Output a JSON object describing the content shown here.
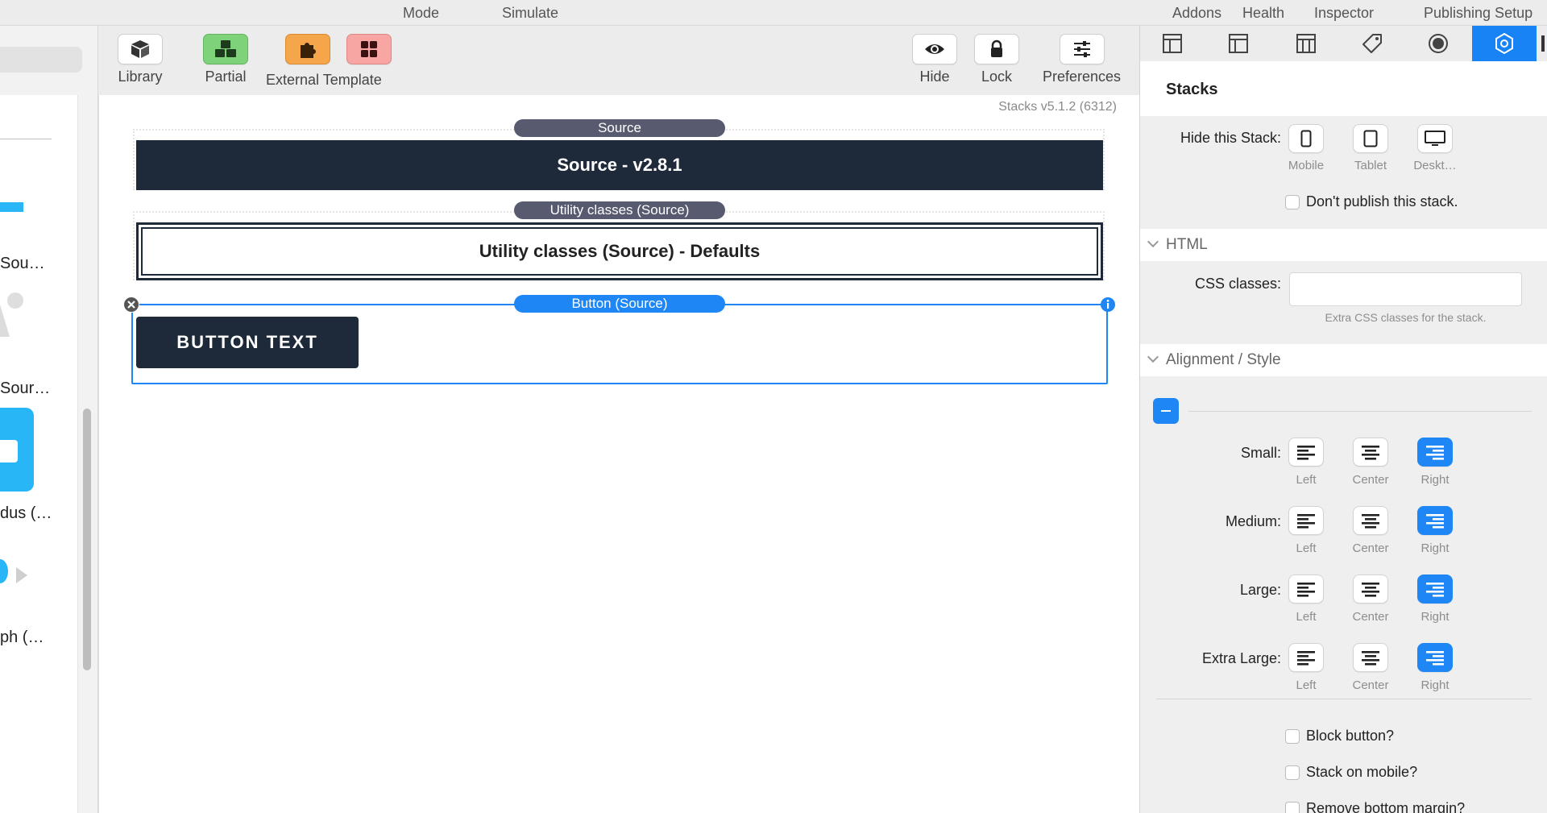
{
  "menubar": {
    "items": [
      "Mode",
      "Simulate",
      "Addons",
      "Health",
      "Inspector",
      "Publishing Setup"
    ]
  },
  "library": {
    "items": [
      "Sou…",
      "Sour…",
      "dus (…",
      "ph (…"
    ]
  },
  "toolbar": {
    "library_label": "Library",
    "partial_label": "Partial",
    "external_template_label": "External Template",
    "hide_label": "Hide",
    "lock_label": "Lock",
    "preferences_label": "Preferences",
    "partial_color": "#7ed27a",
    "external_color": "#f5a54a",
    "template_color": "#f7a6a3"
  },
  "canvas": {
    "version": "Stacks v5.1.2 (6312)",
    "source_tab": "Source",
    "source_banner": "Source - v2.8.1",
    "utility_tab": "Utility classes (Source)",
    "utility_banner": "Utility classes (Source) - Defaults",
    "button_tab": "Button (Source)",
    "button_text": "BUTTON TEXT",
    "dark_color": "#1e2a3a",
    "accent_color": "#1e87f5"
  },
  "inspector": {
    "title": "Stacks",
    "hide_label": "Hide this Stack:",
    "devices": [
      "Mobile",
      "Tablet",
      "Deskt…"
    ],
    "dont_publish": "Don't publish this stack.",
    "html_section": "HTML",
    "css_label": "CSS classes:",
    "css_value": "",
    "css_placeholder": "",
    "css_hint": "Extra CSS classes for the stack.",
    "alignment_section": "Alignment / Style",
    "align_rows": [
      {
        "label": "Small:",
        "selected": "Right"
      },
      {
        "label": "Medium:",
        "selected": "Right"
      },
      {
        "label": "Large:",
        "selected": "Right"
      },
      {
        "label": "Extra Large:",
        "selected": "Right"
      }
    ],
    "align_options": [
      "Left",
      "Center",
      "Right"
    ],
    "options": [
      "Block button?",
      "Stack on mobile?",
      "Remove bottom margin?"
    ]
  }
}
